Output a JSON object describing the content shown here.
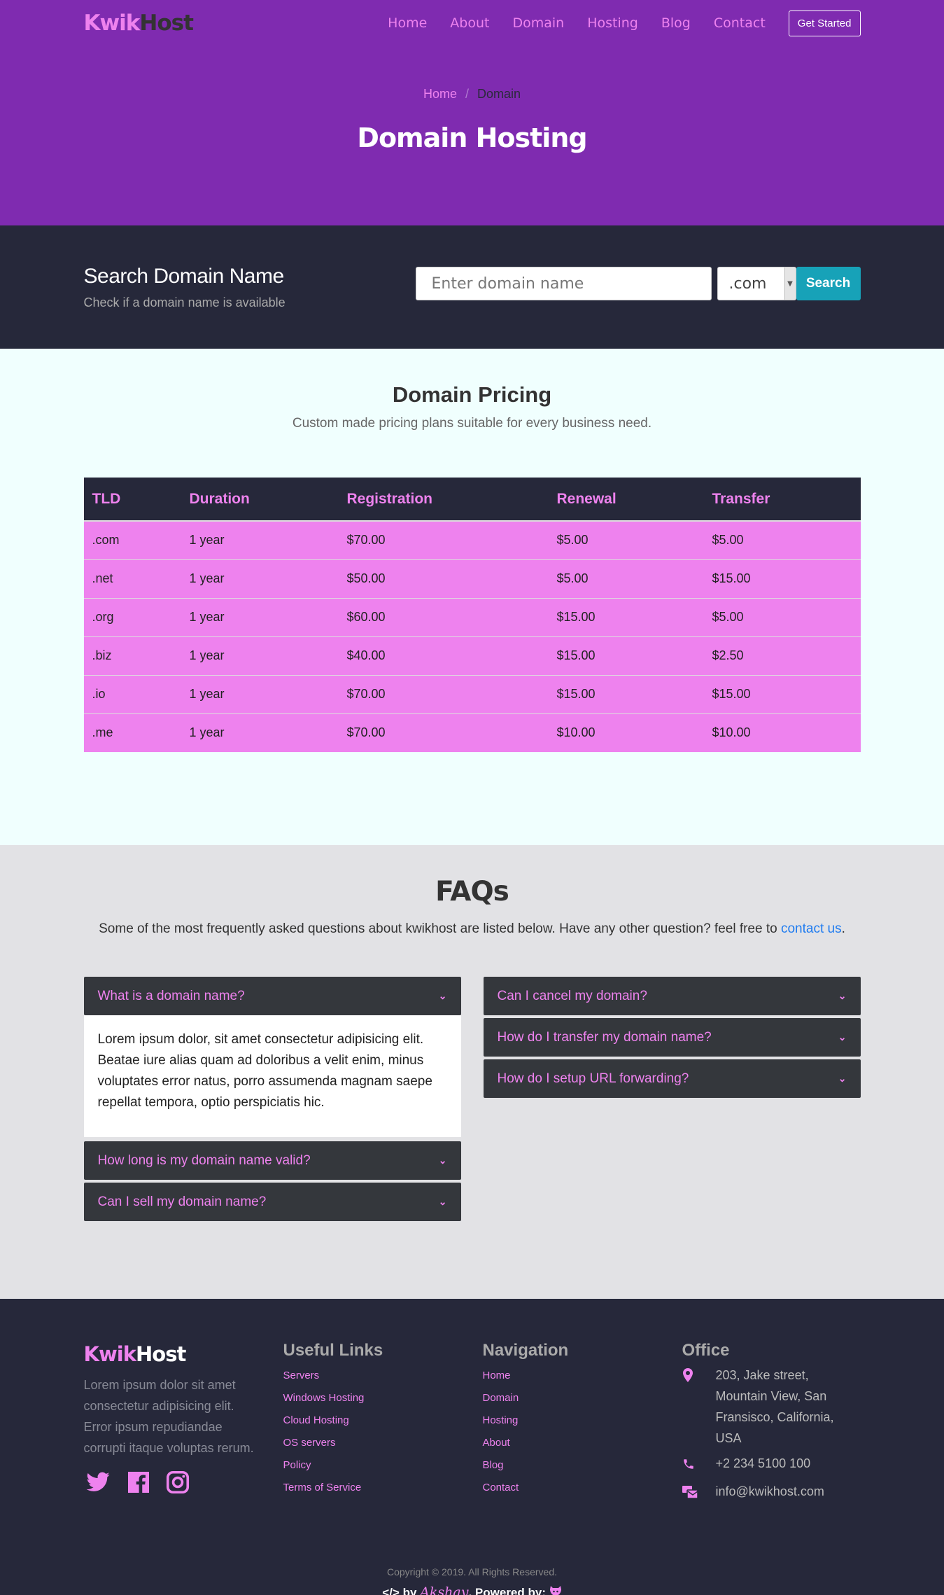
{
  "header": {
    "brand_part1": "Kwik",
    "brand_part2": "Host",
    "nav": [
      "Home",
      "About",
      "Domain",
      "Hosting",
      "Blog",
      "Contact"
    ],
    "cta": "Get Started"
  },
  "hero": {
    "breadcrumb_home": "Home",
    "breadcrumb_sep": "/",
    "breadcrumb_current": "Domain",
    "title": "Domain Hosting"
  },
  "search": {
    "title": "Search Domain Name",
    "subtitle": "Check if a domain name is available",
    "placeholder": "Enter domain name",
    "tld_selected": ".com",
    "button": "Search"
  },
  "pricing": {
    "title": "Domain Pricing",
    "subtitle": "Custom made pricing plans suitable for every business need.",
    "columns": [
      "TLD",
      "Duration",
      "Registration",
      "Renewal",
      "Transfer"
    ],
    "rows": [
      [
        ".com",
        "1 year",
        "$70.00",
        "$5.00",
        "$5.00"
      ],
      [
        ".net",
        "1 year",
        "$50.00",
        "$5.00",
        "$15.00"
      ],
      [
        ".org",
        "1 year",
        "$60.00",
        "$15.00",
        "$5.00"
      ],
      [
        ".biz",
        "1 year",
        "$40.00",
        "$15.00",
        "$2.50"
      ],
      [
        ".io",
        "1 year",
        "$70.00",
        "$15.00",
        "$15.00"
      ],
      [
        ".me",
        "1 year",
        "$70.00",
        "$10.00",
        "$10.00"
      ]
    ]
  },
  "faqs": {
    "title": "FAQs",
    "subtitle": "Some of the most frequently asked questions about kwikhost are listed below. Have any other question? feel free to",
    "contact_link": "contact us",
    "period": ".",
    "left": [
      {
        "q": "What is a domain name?",
        "a": "Lorem ipsum dolor, sit amet consectetur adipisicing elit. Beatae iure alias quam ad doloribus a velit enim, minus voluptates error natus, porro assumenda magnam saepe repellat tempora, optio perspiciatis hic."
      },
      {
        "q": "How long is my domain name valid?"
      },
      {
        "q": "Can I sell my domain name?"
      }
    ],
    "right": [
      {
        "q": "Can I cancel my domain?"
      },
      {
        "q": "How do I transfer my domain name?"
      },
      {
        "q": "How do I setup URL forwarding?"
      }
    ]
  },
  "footer": {
    "brand_part1": "Kwik",
    "brand_part2": "Host",
    "about": "Lorem ipsum dolor sit amet consectetur adipisicing elit. Error ipsum repudiandae corrupti itaque voluptas rerum.",
    "useful_links_title": "Useful Links",
    "useful_links": [
      "Servers",
      "Windows Hosting",
      "Cloud Hosting",
      "OS servers",
      "Policy",
      "Terms of Service"
    ],
    "navigation_title": "Navigation",
    "navigation": [
      "Home",
      "Domain",
      "Hosting",
      "About",
      "Blog",
      "Contact"
    ],
    "office_title": "Office",
    "address": "203, Jake street, Mountain View, San Fransisco, California, USA",
    "phone": "+2 234 5100 100",
    "email": "info@kwikhost.com",
    "copyright": "Copyright © 2019. All Rights Reserved.",
    "credit_by": "by",
    "credit_name": "Akshay",
    "credit_powered": ". Powered by:"
  },
  "colors": {
    "accent": "#ee82ee",
    "hero_bg": "#7f2bb0",
    "dark": "#26283a",
    "search_button": "#17a2b8",
    "pricing_bg": "#f0fffe",
    "faq_bg": "#e2e2e5"
  }
}
